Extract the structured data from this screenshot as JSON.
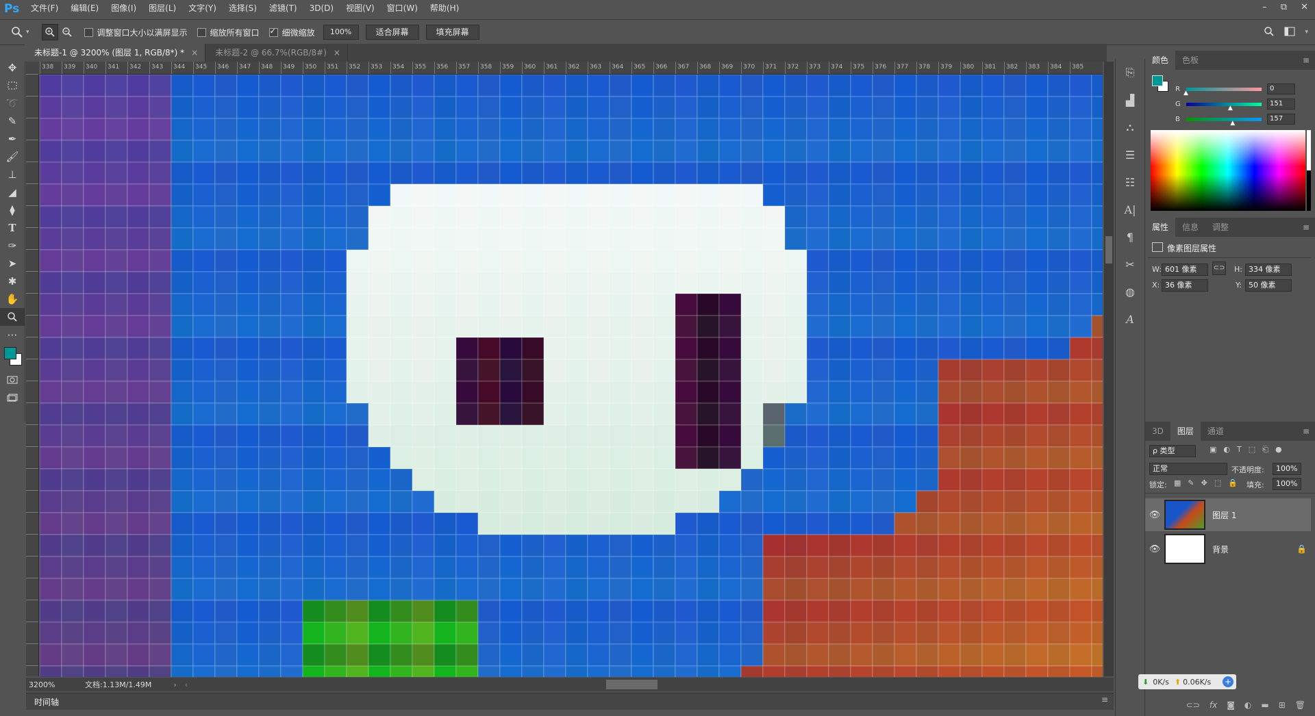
{
  "app": {
    "logo": "Ps"
  },
  "menu": [
    "文件(F)",
    "编辑(E)",
    "图像(I)",
    "图层(L)",
    "文字(Y)",
    "选择(S)",
    "滤镜(T)",
    "3D(D)",
    "视图(V)",
    "窗口(W)",
    "帮助(H)"
  ],
  "window_controls": {
    "minimize": "–",
    "restore": "⧉",
    "close": "✕"
  },
  "options": {
    "resize_windows_label": "调整窗口大小以满屏显示",
    "resize_windows_checked": false,
    "zoom_all_label": "缩放所有窗口",
    "zoom_all_checked": false,
    "scrubby_zoom_label": "细微缩放",
    "scrubby_zoom_checked": true,
    "zoom_value": "100%",
    "fit_screen": "适合屏幕",
    "fill_screen": "填充屏幕"
  },
  "tabs": [
    {
      "label": "未标题-1 @ 3200% (图层 1, RGB/8*) *",
      "active": true
    },
    {
      "label": "未标题-2 @ 66.7%(RGB/8#)",
      "active": false
    }
  ],
  "ruler_ticks": [
    "338",
    "339",
    "340",
    "341",
    "342",
    "343",
    "344",
    "345",
    "346",
    "347",
    "348",
    "349",
    "350",
    "351",
    "352",
    "353",
    "354",
    "355",
    "356",
    "357",
    "358",
    "359",
    "360",
    "361",
    "362",
    "363",
    "364",
    "365",
    "366",
    "367",
    "368",
    "369",
    "370",
    "371",
    "372",
    "373",
    "374",
    "375",
    "376",
    "377",
    "378",
    "379",
    "380",
    "381",
    "382",
    "383",
    "384",
    "385"
  ],
  "status": {
    "zoom": "3200%",
    "doc": "文档:1.13M/1.49M"
  },
  "timeline_label": "时间轴",
  "color_panel": {
    "tabs": [
      "颜色",
      "色板"
    ],
    "foreground": "#009799",
    "r_label": "R",
    "r": "0",
    "g_label": "G",
    "g": "151",
    "b_label": "B",
    "b": "157",
    "r_frac": 0.0,
    "g_frac": 0.59,
    "b_frac": 0.62
  },
  "properties_panel": {
    "tabs": [
      "属性",
      "信息",
      "调整"
    ],
    "title": "像素图层属性",
    "w_label": "W:",
    "w": "601 像素",
    "h_label": "H:",
    "h": "334 像素",
    "x_label": "X:",
    "x": "36 像素",
    "y_label": "Y:",
    "y": "50 像素"
  },
  "layers_panel": {
    "tabs": [
      "3D",
      "图层",
      "通道"
    ],
    "filter": "ρ 类型",
    "blend": "正常",
    "opacity_label": "不透明度:",
    "opacity": "100%",
    "lock_label": "锁定:",
    "fill_label": "填充:",
    "fill": "100%",
    "layers": [
      {
        "name": "图层 1",
        "selected": true
      },
      {
        "name": "背景",
        "selected": false,
        "locked": true
      }
    ]
  },
  "net": {
    "down": "0K/s",
    "up": "0.06K/s"
  }
}
